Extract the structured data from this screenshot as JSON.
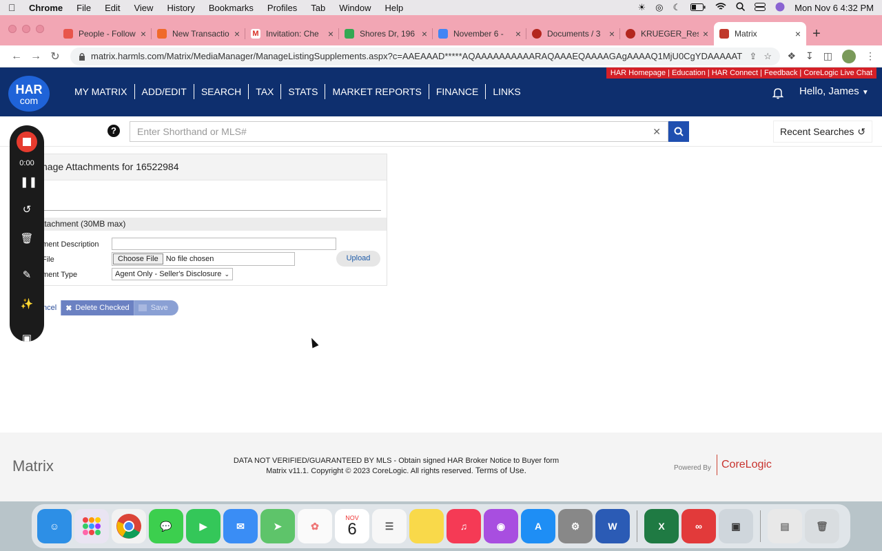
{
  "menubar": {
    "app": "Chrome",
    "items": [
      "File",
      "Edit",
      "View",
      "History",
      "Bookmarks",
      "Profiles",
      "Tab",
      "Window",
      "Help"
    ],
    "datetime": "Mon Nov 6  4:32 PM"
  },
  "tabs": [
    {
      "title": "People - Follow",
      "color": "#e8554b"
    },
    {
      "title": "New Transactio",
      "color": "#f06a2a"
    },
    {
      "title": "Invitation: Che",
      "color": "#d93025"
    },
    {
      "title": "Shores Dr, 196",
      "color": "#34a853"
    },
    {
      "title": "November 6 - ",
      "color": "#4285f4"
    },
    {
      "title": "Documents / 3",
      "color": "#b3261e"
    },
    {
      "title": "KRUEGER_Res",
      "color": "#b3261e"
    },
    {
      "title": "Matrix",
      "color": "#c0392b"
    }
  ],
  "omnibox": {
    "url": "matrix.harmls.com/Matrix/MediaManager/ManageListingSupplements.aspx?c=AAEAAAD*****AQAAAAAAAAAARAQAAAEQAAAAGAgAAAAQ1MjU0CgYDAAAAAT..."
  },
  "har": {
    "top_links": "HAR Homepage | Education | HAR Connect | Feedback | CoreLogic Live Chat",
    "logo_top": "HAR",
    "logo_bottom": "com",
    "nav": [
      "MY MATRIX",
      "ADD/EDIT",
      "SEARCH",
      "TAX",
      "STATS",
      "MARKET REPORTS",
      "FINANCE",
      "LINKS"
    ],
    "greeting": "Hello, James",
    "help_glyph": "?",
    "search_placeholder": "Enter Shorthand or MLS#",
    "recent_searches": "Recent Searches"
  },
  "panel": {
    "title": "nage Attachments for 16522984",
    "section": "ttachment (30MB max)",
    "desc_label": "ment Description",
    "file_label": "File",
    "type_label": "ment Type",
    "choose_file": "Choose File",
    "no_file": "No file chosen",
    "upload": "Upload",
    "type_value": "Agent Only - Seller's Disclosure"
  },
  "actions": {
    "cancel": "ncel",
    "delete": "Delete Checked",
    "save": "Save"
  },
  "footer": {
    "brand": "Matrix",
    "line1": "DATA NOT VERIFIED/GUARANTEED BY MLS - Obtain signed HAR Broker Notice to Buyer form",
    "line2": "Matrix v11.1. Copyright © 2023 CoreLogic. All rights reserved.",
    "terms": "Terms of Use.",
    "powered": "Powered By",
    "corelogic": "CoreLogic"
  },
  "recorder": {
    "time": "0:00"
  },
  "dock": {
    "calendar_month": "NOV",
    "calendar_day": "6"
  }
}
